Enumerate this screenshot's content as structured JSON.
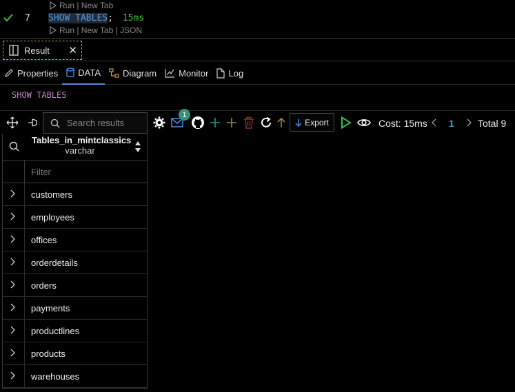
{
  "editor": {
    "codelens_top": "Run | New Tab",
    "line_number": "7",
    "statement": "SHOW TABLES",
    "semicolon": ";",
    "duration": "15ms",
    "codelens_bottom": "Run | New Tab | JSON"
  },
  "result_tab": {
    "label": "Result"
  },
  "subtabs": [
    {
      "label": "Properties"
    },
    {
      "label": "DATA"
    },
    {
      "label": "Diagram"
    },
    {
      "label": "Monitor"
    },
    {
      "label": "Log"
    }
  ],
  "query_text": "SHOW TABLES",
  "toolbar": {
    "search_placeholder": "Search results",
    "notification_count": "1",
    "export_label": "Export",
    "cost": "Cost: 15ms",
    "page": "1",
    "total": "Total 9"
  },
  "grid": {
    "column_name": "Tables_in_mintclassics",
    "column_type": "varchar",
    "filter_placeholder": "Filter",
    "rows": [
      "customers",
      "employees",
      "offices",
      "orderdetails",
      "orders",
      "payments",
      "productlines",
      "products",
      "warehouses"
    ]
  },
  "colors": {
    "keyword": "#569cd6",
    "duration": "#3ec23e",
    "query": "#c586c0",
    "active_tab": "#4a90e2",
    "badge": "#3a8f7a"
  }
}
